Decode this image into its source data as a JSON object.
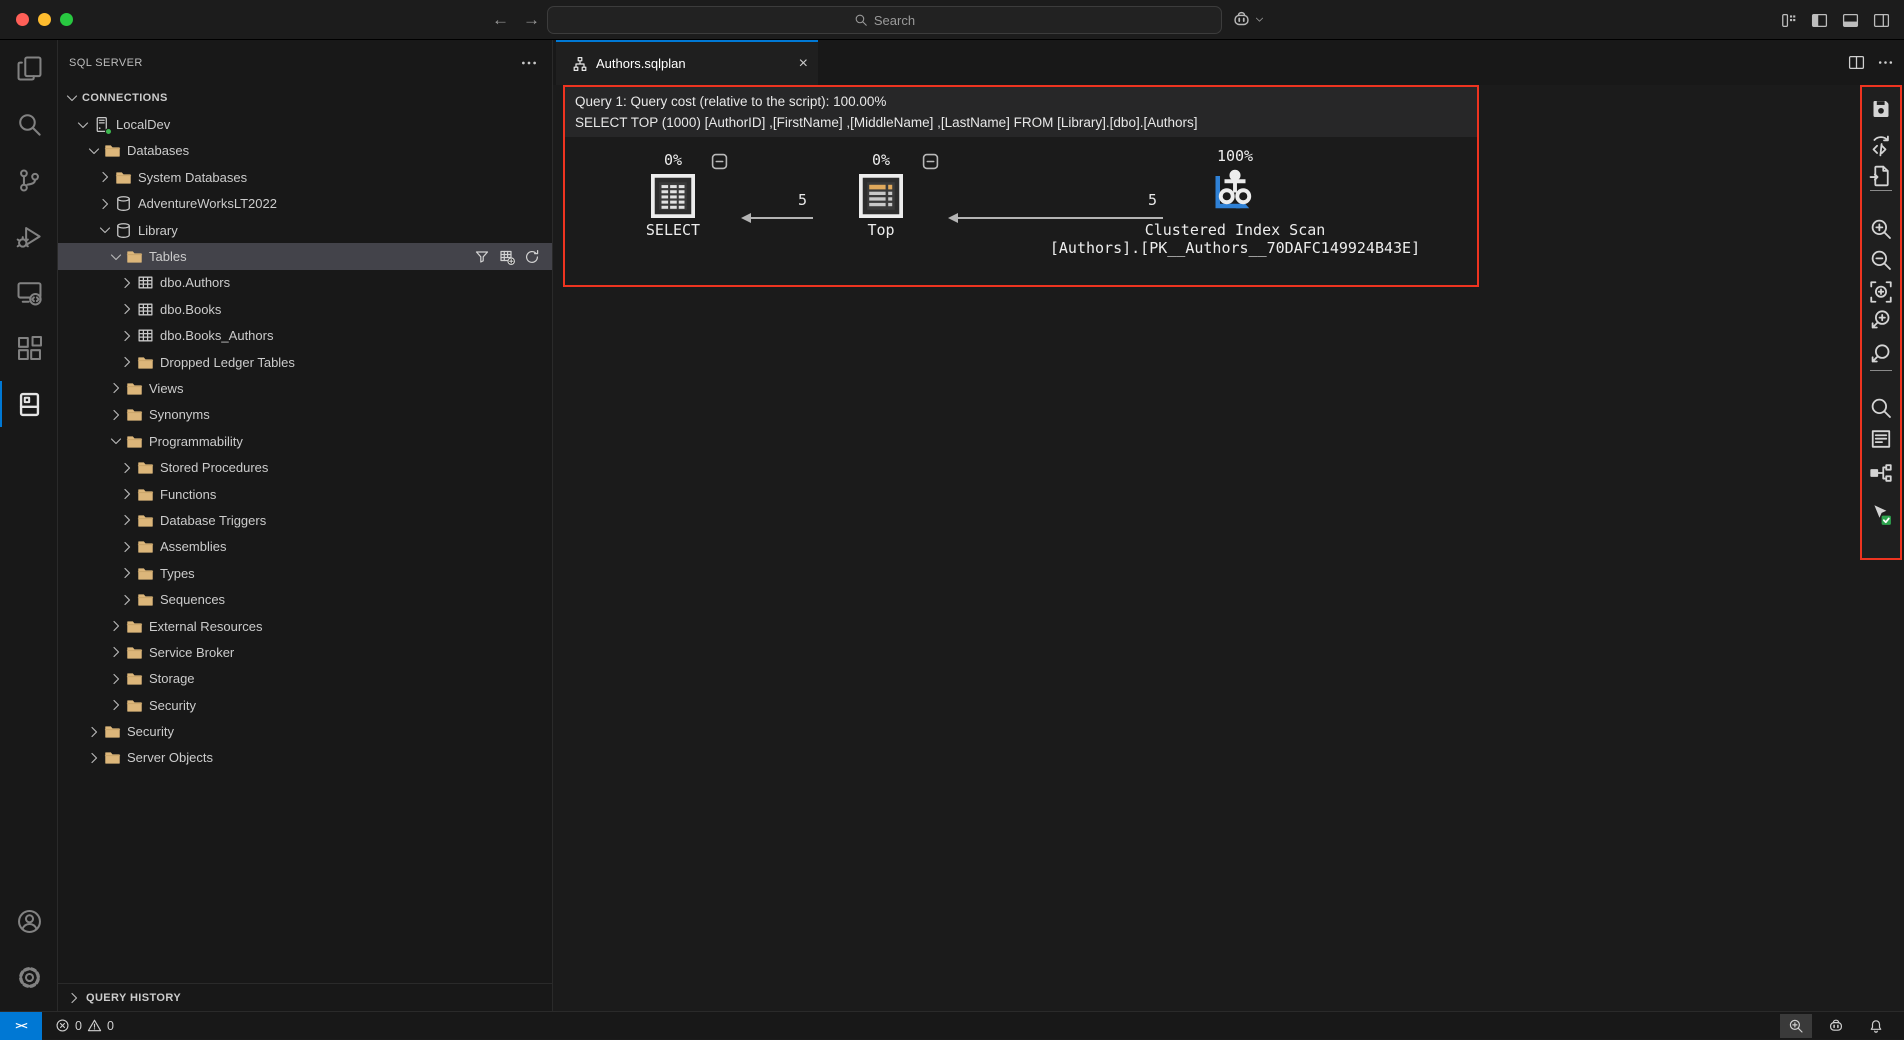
{
  "titlebar": {
    "traffic_lights": [
      "close",
      "minimize",
      "zoom"
    ],
    "nav_back": "←",
    "nav_forward": "→",
    "search_placeholder": "Search",
    "icons": [
      "search-icon",
      "copilot-icon",
      "chevron-down-icon",
      "customize-layout-icon",
      "toggle-panel-left-icon",
      "toggle-panel-bottom-icon",
      "toggle-panel-right-icon"
    ]
  },
  "activity_bar": {
    "items": [
      {
        "name": "explorer",
        "icon": "files-icon",
        "active": false
      },
      {
        "name": "search",
        "icon": "search-icon",
        "active": false
      },
      {
        "name": "source-control",
        "icon": "source-control-icon",
        "active": false
      },
      {
        "name": "run-and-debug",
        "icon": "run-debug-icon",
        "active": false
      },
      {
        "name": "remote-explorer",
        "icon": "remote-explorer-icon",
        "active": false
      },
      {
        "name": "extensions",
        "icon": "extensions-icon",
        "active": false
      },
      {
        "name": "sql-server",
        "icon": "sql-server-icon",
        "active": true
      }
    ],
    "bottom_items": [
      {
        "name": "accounts",
        "icon": "account-icon"
      },
      {
        "name": "settings",
        "icon": "settings-gear-icon"
      }
    ]
  },
  "sidebar": {
    "title": "SQL SERVER",
    "more_icon": "more-icon",
    "tree": [
      {
        "label": "CONNECTIONS",
        "depth": 0,
        "chevron": "down",
        "icon": null,
        "section": true
      },
      {
        "label": "LocalDev",
        "depth": 1,
        "chevron": "down",
        "icon": "server-icon",
        "status_dot": true
      },
      {
        "label": "Databases",
        "depth": 2,
        "chevron": "down",
        "icon": "folder-icon"
      },
      {
        "label": "System Databases",
        "depth": 3,
        "chevron": "right",
        "icon": "folder-icon"
      },
      {
        "label": "AdventureWorksLT2022",
        "depth": 3,
        "chevron": "right",
        "icon": "database-icon"
      },
      {
        "label": "Library",
        "depth": 3,
        "chevron": "down",
        "icon": "database-icon"
      },
      {
        "label": "Tables",
        "depth": 4,
        "chevron": "down",
        "icon": "folder-icon",
        "selected": true,
        "actions": [
          "filter-icon",
          "new-table-icon",
          "refresh-icon"
        ]
      },
      {
        "label": "dbo.Authors",
        "depth": 5,
        "chevron": "right",
        "icon": "table-icon"
      },
      {
        "label": "dbo.Books",
        "depth": 5,
        "chevron": "right",
        "icon": "table-icon"
      },
      {
        "label": "dbo.Books_Authors",
        "depth": 5,
        "chevron": "right",
        "icon": "table-icon"
      },
      {
        "label": "Dropped Ledger Tables",
        "depth": 5,
        "chevron": "right",
        "icon": "folder-icon"
      },
      {
        "label": "Views",
        "depth": 4,
        "chevron": "right",
        "icon": "folder-icon"
      },
      {
        "label": "Synonyms",
        "depth": 4,
        "chevron": "right",
        "icon": "folder-icon"
      },
      {
        "label": "Programmability",
        "depth": 4,
        "chevron": "down",
        "icon": "folder-icon"
      },
      {
        "label": "Stored Procedures",
        "depth": 5,
        "chevron": "right",
        "icon": "folder-icon"
      },
      {
        "label": "Functions",
        "depth": 5,
        "chevron": "right",
        "icon": "folder-icon"
      },
      {
        "label": "Database Triggers",
        "depth": 5,
        "chevron": "right",
        "icon": "folder-icon"
      },
      {
        "label": "Assemblies",
        "depth": 5,
        "chevron": "right",
        "icon": "folder-icon"
      },
      {
        "label": "Types",
        "depth": 5,
        "chevron": "right",
        "icon": "folder-icon"
      },
      {
        "label": "Sequences",
        "depth": 5,
        "chevron": "right",
        "icon": "folder-icon"
      },
      {
        "label": "External Resources",
        "depth": 4,
        "chevron": "right",
        "icon": "folder-icon"
      },
      {
        "label": "Service Broker",
        "depth": 4,
        "chevron": "right",
        "icon": "folder-icon"
      },
      {
        "label": "Storage",
        "depth": 4,
        "chevron": "right",
        "icon": "folder-icon"
      },
      {
        "label": "Security",
        "depth": 4,
        "chevron": "right",
        "icon": "folder-icon"
      },
      {
        "label": "Security",
        "depth": 2,
        "chevron": "right",
        "icon": "folder-icon"
      },
      {
        "label": "Server Objects",
        "depth": 2,
        "chevron": "right",
        "icon": "folder-icon"
      }
    ],
    "bottom_panel": {
      "label": "QUERY HISTORY"
    }
  },
  "editor": {
    "tab": {
      "label": "Authors.sqlplan",
      "icon": "query-plan-icon",
      "close": "×"
    },
    "tabbar_icons": [
      "split-editor-icon",
      "more-icon"
    ],
    "plan": {
      "header_line1": "Query 1: Query cost (relative to the script): 100.00%",
      "header_line2": "SELECT TOP (1000) [AuthorID] ,[FirstName] ,[MiddleName] ,[LastName] FROM [Library].[dbo].[Authors]",
      "nodes": [
        {
          "id": "select",
          "percent": "0%",
          "label": "SELECT",
          "icon": "node-select-icon"
        },
        {
          "id": "top",
          "percent": "0%",
          "label": "Top",
          "icon": "node-top-icon"
        },
        {
          "id": "clustered-index-scan",
          "percent": "100%",
          "label": "Clustered Index Scan",
          "sublabel": "[Authors].[PK__Authors__70DAFC149924B43E]",
          "icon": "node-cis-icon"
        }
      ],
      "edges": [
        {
          "rows": "5"
        },
        {
          "rows": "5"
        }
      ]
    },
    "plan_toolbar": [
      "save-plan-icon",
      "show-query-xml-icon",
      "open-plan-file-icon",
      "zoom-in-icon",
      "zoom-out-icon",
      "zoom-to-fit-icon",
      "custom-zoom-icon",
      "highlight-expensive-operation-icon",
      "find-node-icon",
      "properties-icon",
      "compare-plan-icon",
      "toggle-tooltips-icon"
    ]
  },
  "status_bar": {
    "remote_indicator": "><",
    "errors": "0",
    "warnings": "0",
    "right_icons": [
      "zoom-in-icon",
      "copilot-icon",
      "bell-icon"
    ]
  },
  "colors": {
    "accent": "#0078d4",
    "annotation_red": "#ee3420",
    "folder": "#dcb67a",
    "remote_bg": "#0078d4",
    "status_green": "#3fb950"
  }
}
